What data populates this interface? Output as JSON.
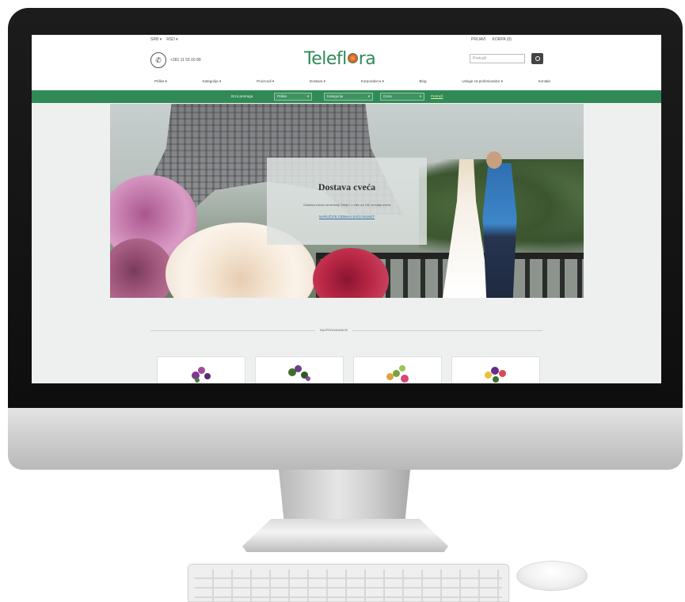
{
  "topbar": {
    "left_items": [
      "SRB ▾",
      "RSD ▾"
    ],
    "right_items": [
      "PRIJAVI",
      "KORPA (0)"
    ]
  },
  "header": {
    "phone": "+381 11 55 00 88",
    "logo_text_left": "Telefl",
    "logo_text_right": "ra",
    "search_placeholder": "Pretraži"
  },
  "nav": {
    "items": [
      "Prilike ▾",
      "Kategorije ▾",
      "Proizvodi ▾",
      "Dostava ▾",
      "Korporativno ▾",
      "Blog",
      "Usluge za profesionalce ▾",
      "Kontakt"
    ]
  },
  "filter": {
    "label": "Brza pretraga",
    "selects": [
      "Prilike",
      "Kategorije",
      "Cena"
    ],
    "action": "Pretraži"
  },
  "hero": {
    "title": "Dostava cveća",
    "text": "Dostava cveća na teritoriji Srbije i u više od 100 zemalja sveta",
    "link": "NARUČITE ODMAH SVOJ BUKET"
  },
  "section": {
    "label": "NAJPRODAVANIJE"
  },
  "products": [
    {
      "name": "product-1",
      "color": "#7b3a8e"
    },
    {
      "name": "product-2",
      "color": "#5a7a3a"
    },
    {
      "name": "product-3",
      "color": "#d9733a"
    },
    {
      "name": "product-4",
      "color": "#e6c23a"
    }
  ]
}
